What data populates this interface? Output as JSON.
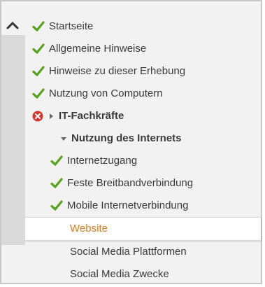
{
  "nav": {
    "items": [
      {
        "label": "Startseite",
        "icon": "check-icon"
      },
      {
        "label": "Allgemeine Hinweise",
        "icon": "check-icon"
      },
      {
        "label": "Hinweise zu dieser Erhebung",
        "icon": "check-icon"
      },
      {
        "label": "Nutzung von Computern",
        "icon": "check-icon"
      },
      {
        "label": "IT-Fachkräfte",
        "icon": "error-icon",
        "expand": "caret-right-icon"
      },
      {
        "label": "Nutzung des Internets",
        "expand": "caret-down-icon"
      },
      {
        "label": "Internetzugang",
        "icon": "check-icon"
      },
      {
        "label": "Feste Breitbandverbindung",
        "icon": "check-icon"
      },
      {
        "label": "Mobile Internetverbindung",
        "icon": "check-icon"
      },
      {
        "label": "Website",
        "active": true
      },
      {
        "label": "Social Media Plattformen"
      },
      {
        "label": "Social Media Zwecke"
      }
    ]
  },
  "colors": {
    "check": "#56a31e",
    "error": "#d9342b",
    "active_text": "#e07a1a",
    "text": "#3a3a3a"
  }
}
